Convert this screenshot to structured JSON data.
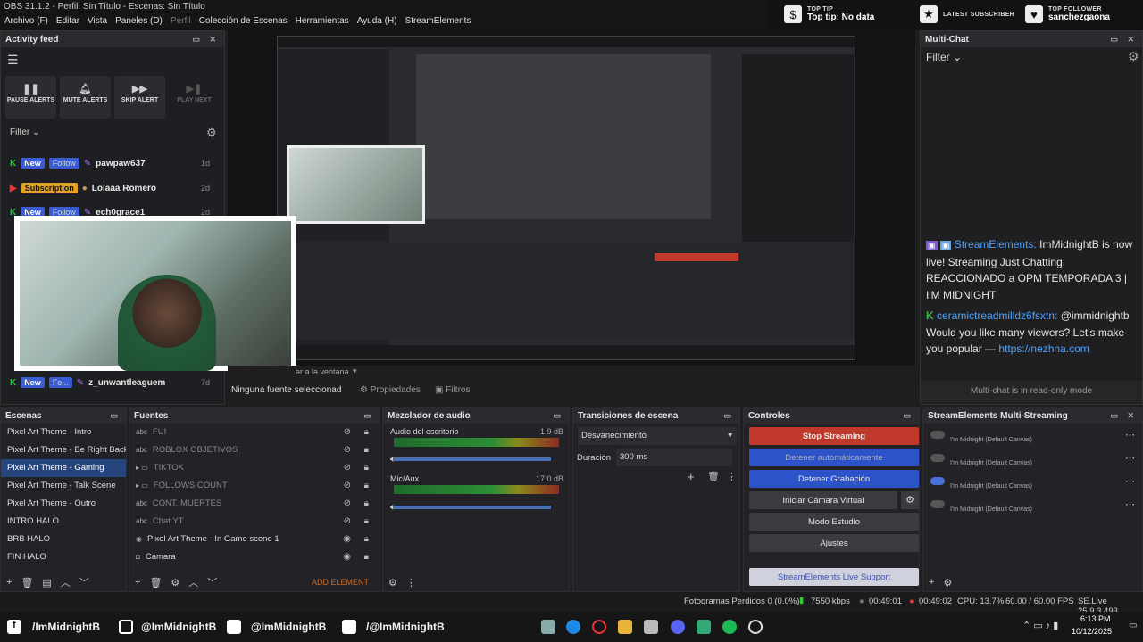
{
  "window": {
    "title": "OBS 31.1.2 - Perfil: Sin Título - Escenas: Sin Título"
  },
  "menu": [
    "Archivo (F)",
    "Editar",
    "Vista",
    "Paneles (D)",
    "Perfil",
    "Colección de Escenas",
    "Herramientas",
    "Ayuda (H)",
    "StreamElements"
  ],
  "topstats": {
    "tip_label": "TOP TIP",
    "tip_value": "Top tip: No data",
    "sub_label": "LATEST SUBSCRIBER",
    "follower_label": "TOP FOLLOWER",
    "follower_value": "sanchezgaona"
  },
  "activity": {
    "title": "Activity feed",
    "pause": "PAUSE ALERTS",
    "mute": "MUTE ALERTS",
    "skip": "SKIP ALERT",
    "play": "PLAY NEXT",
    "filter": "Filter",
    "rows": [
      {
        "badge1": "New",
        "badge2": "Follow",
        "name": "pawpaw637",
        "age": "1d"
      },
      {
        "badge1": "Subscription",
        "name": "Lolaaa Romero",
        "age": "2d"
      },
      {
        "badge1": "New",
        "badge2": "Follow",
        "name": "ech0grace1",
        "age": "2d"
      },
      {
        "badge1": "New",
        "badge2": "Fo...",
        "name": "z_unwantleaguem",
        "age": "7d"
      }
    ]
  },
  "preview": {
    "status_label": "Ninguna fuente seleccionad",
    "props": "Propiedades",
    "filters": "Filtros",
    "fit": "ar a la ventana"
  },
  "multichat": {
    "title": "Multi-Chat",
    "filter": "Filter",
    "msg1_name": "StreamElements:",
    "msg1_text": "ImMidnightB is now live! Streaming Just Chatting: REACCIONADO a OPM TEMPORADA 3 | I'M MIDNIGHT",
    "msg2_name": "ceramictreadmilldz6fsxtn:",
    "msg2_text": "@immidnightb Would you like many viewers? Let's make you popular —",
    "msg2_link": "https://nezhna.com",
    "readonly": "Multi-chat is in read-only mode"
  },
  "scenes": {
    "title": "Escenas",
    "items": [
      "Pixel Art Theme - Intro",
      "Pixel Art Theme - Be Right Back 1",
      "Pixel Art Theme - Gaming",
      "Pixel Art Theme - Talk Scene",
      "Pixel Art Theme - Outro",
      "INTRO HALO",
      "BRB HALO",
      "FIN HALO"
    ],
    "selected": 2
  },
  "sources": {
    "title": "Fuentes",
    "add": "ADD ELEMENT",
    "items": [
      "FUI",
      "ROBLOX OBJETIVOS",
      "TIKTOK",
      "FOLLOWS COUNT",
      "CONT. MUERTES",
      "Chat YT",
      "Pixel Art Theme - In Game scene 1",
      "Camara"
    ]
  },
  "audio": {
    "title": "Mezclador de audio",
    "ch1": "Audio del escritorio",
    "ch1_db": "-1.9 dB",
    "ch2": "Mic/Aux",
    "ch2_db": "17.0 dB",
    "scale": [
      "-60",
      "-55",
      "-50",
      "-45",
      "-40",
      "-35",
      "-30",
      "-25",
      "-20",
      "-15",
      "-10",
      "-5",
      "0"
    ]
  },
  "transitions": {
    "title": "Transiciones de escena",
    "type": "Desvanecimiento",
    "dur_label": "Duración",
    "dur_value": "300 ms"
  },
  "controls": {
    "title": "Controles",
    "stop": "Stop Streaming",
    "auto": "Detener automáticamente",
    "rec": "Detener Grabación",
    "vcam": "Iniciar Cámara Virtual",
    "studio": "Modo Estudio",
    "settings": "Ajustes",
    "support": "StreamElements Live Support"
  },
  "multistream": {
    "title": "StreamElements Multi-Streaming",
    "rows": [
      "I'm Midnight (Default Canvas)",
      "I'm Midnight (Default Canvas)",
      "I'm Midnight (Default Canvas)",
      "I'm Midnight (Default Canvas)"
    ]
  },
  "status": {
    "dropped": "Fotogramas Perdidos 0 (0.0%)",
    "kbps": "7550 kbps",
    "t1": "00:49:01",
    "t2": "00:49:02",
    "cpu": "CPU: 13.7%",
    "fps": "60.00 / 60.00 FPS",
    "se": "SE.Live 25.9.3.493"
  },
  "taskbar": {
    "fb": "/ImMidnightB",
    "ig": "@ImMidnightB",
    "tw": "@ImMidnightB",
    "yt": "/@ImMidnightB",
    "time": "6:13 PM",
    "date": "10/12/2025"
  },
  "colors": {
    "accent": "#27457d",
    "stop": "#c0392b",
    "blue": "#2d53c9",
    "se": "#4da3ff"
  }
}
